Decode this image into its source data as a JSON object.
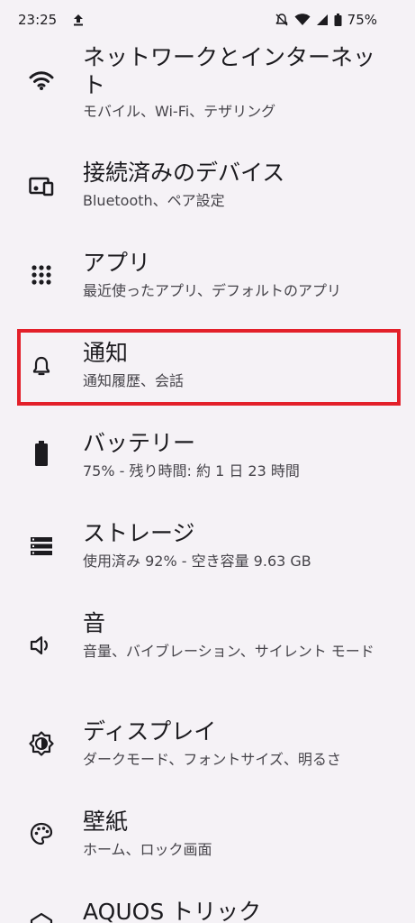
{
  "status": {
    "time": "23:25",
    "battery": "75%"
  },
  "items": [
    {
      "title": "ネットワークとインターネット",
      "subtitle": "モバイル、Wi-Fi、テザリング",
      "icon": "wifi-icon"
    },
    {
      "title": "接続済みのデバイス",
      "subtitle": "Bluetooth、ペア設定",
      "icon": "devices-icon"
    },
    {
      "title": "アプリ",
      "subtitle": "最近使ったアプリ、デフォルトのアプリ",
      "icon": "apps-grid-icon"
    },
    {
      "title": "通知",
      "subtitle": "通知履歴、会話",
      "icon": "bell-icon"
    },
    {
      "title": "バッテリー",
      "subtitle": "75% - 残り時間: 約 1 日 23 時間",
      "icon": "battery-icon"
    },
    {
      "title": "ストレージ",
      "subtitle": "使用済み 92% - 空き容量 9.63 GB",
      "icon": "storage-icon"
    },
    {
      "title": "音",
      "subtitle": "音量、バイブレーション、サイレント モード",
      "icon": "speaker-icon"
    },
    {
      "title": "ディスプレイ",
      "subtitle": "ダークモード、フォントサイズ、明るさ",
      "icon": "brightness-icon"
    },
    {
      "title": "壁紙",
      "subtitle": "ホーム、ロック画面",
      "icon": "palette-icon"
    },
    {
      "title": "AQUOS トリック",
      "subtitle": "",
      "icon": "aquos-trick-icon"
    }
  ],
  "highlight_color": "#e3202a"
}
